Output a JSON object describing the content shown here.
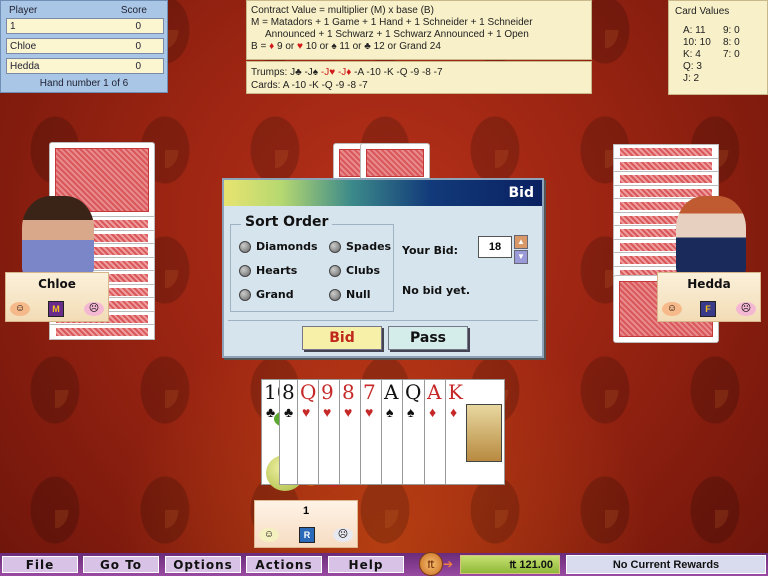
{
  "scoreboard": {
    "col_player": "Player",
    "col_score": "Score",
    "rows": [
      {
        "player": "1",
        "score": "0"
      },
      {
        "player": "Chloe",
        "score": "0"
      },
      {
        "player": "Hedda",
        "score": "0"
      }
    ],
    "hand_number": "Hand number 1 of 6"
  },
  "contract": {
    "line1": "Contract Value = multiplier (M) x base (B)",
    "line2": "M = Matadors + 1 Game + 1 Hand + 1 Schneider + 1 Schneider",
    "line3": "Announced + 1 Schwarz + 1 Schwarz Announced + 1 Open",
    "base_prefix": "B =",
    "bases": [
      {
        "suit": "♦",
        "value": "9"
      },
      {
        "suit": "♥",
        "value": "10"
      },
      {
        "suit": "♠",
        "value": "11"
      },
      {
        "suit": "♣",
        "value": "12"
      }
    ],
    "or": "or",
    "grand": "Grand  24"
  },
  "trumps": {
    "label": "Trumps:",
    "jacks": [
      "J♣",
      "-J♠",
      "-J♥",
      "-J♦"
    ],
    "rest": " -A -10 -K -Q -9 -8 -7",
    "cards_label": "Cards:",
    "cards": "A -10 -K -Q -9 -8 -7"
  },
  "card_values": {
    "title": "Card Values",
    "left": [
      "A:   11",
      "10:  10",
      "K:   4",
      "Q:   3",
      "J:   2"
    ],
    "right": [
      "9:  0",
      "8:  0",
      "7:  0"
    ]
  },
  "opponents": [
    {
      "name": "Chloe",
      "badge": "M"
    },
    {
      "name": "Hedda",
      "badge": "F"
    }
  ],
  "dialog": {
    "title": "Bid",
    "sort_order_label": "Sort Order",
    "sort_options": [
      "Diamonds",
      "Spades",
      "Hearts",
      "Clubs",
      "Grand",
      "Null"
    ],
    "your_bid_label": "Your Bid:",
    "bid_value": "18",
    "status": "No bid yet.",
    "bid_button": "Bid",
    "pass_button": "Pass",
    "up_arrow": "▲",
    "down_arrow": "▼"
  },
  "hand": [
    {
      "rank": "10",
      "suit": "♣",
      "color": "black"
    },
    {
      "rank": "8",
      "suit": "♣",
      "color": "black"
    },
    {
      "rank": "Q",
      "suit": "♥",
      "color": "red"
    },
    {
      "rank": "9",
      "suit": "♥",
      "color": "red"
    },
    {
      "rank": "8",
      "suit": "♥",
      "color": "red"
    },
    {
      "rank": "7",
      "suit": "♥",
      "color": "red"
    },
    {
      "rank": "A",
      "suit": "♠",
      "color": "black"
    },
    {
      "rank": "Q",
      "suit": "♠",
      "color": "black"
    },
    {
      "rank": "A",
      "suit": "♦",
      "color": "red"
    },
    {
      "rank": "K",
      "suit": "♦",
      "color": "red"
    }
  ],
  "player": {
    "name": "1",
    "badge": "R"
  },
  "menu": [
    "File",
    "Go To",
    "Options",
    "Actions",
    "Help"
  ],
  "currency_symbol": "₶",
  "balance": "₶ 121.00",
  "rewards": "No Current Rewards",
  "colors": {
    "table_red": "#9a2412",
    "dialog_bg": "#d6e4ee",
    "menu_purple": "#7a3a8a",
    "bid_button": "#f6f0a8",
    "pass_button": "#d4ecea"
  }
}
